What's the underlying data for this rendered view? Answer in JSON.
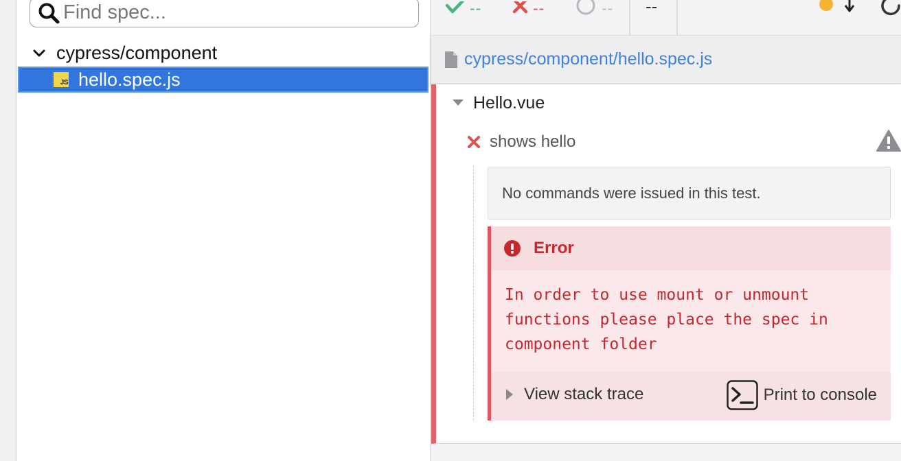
{
  "explorer": {
    "search": {
      "placeholder": "Find spec...",
      "value": ""
    },
    "folder": {
      "label": "cypress/component"
    },
    "file": {
      "label": "hello.spec.js",
      "badge": "JS"
    }
  },
  "stats": {
    "passed": "--",
    "failed": "--",
    "pending": "--",
    "duration": "--"
  },
  "spec": {
    "path": "cypress/component/hello.spec.js"
  },
  "suite": {
    "title": "Hello.vue"
  },
  "test": {
    "title": "shows hello",
    "no_commands": "No commands were issued in this test."
  },
  "error": {
    "title": "Error",
    "message": "In order to use mount or unmount\nfunctions please place the spec in\ncomponent folder",
    "stack_trace_label": "View stack trace",
    "print_label": "Print to console"
  },
  "colors": {
    "selection": "#3275dc",
    "link": "#3c82e2",
    "passed": "#47b37f",
    "failed": "#d9524e",
    "error_text": "#c4282f",
    "running_dot": "#f3b531"
  }
}
